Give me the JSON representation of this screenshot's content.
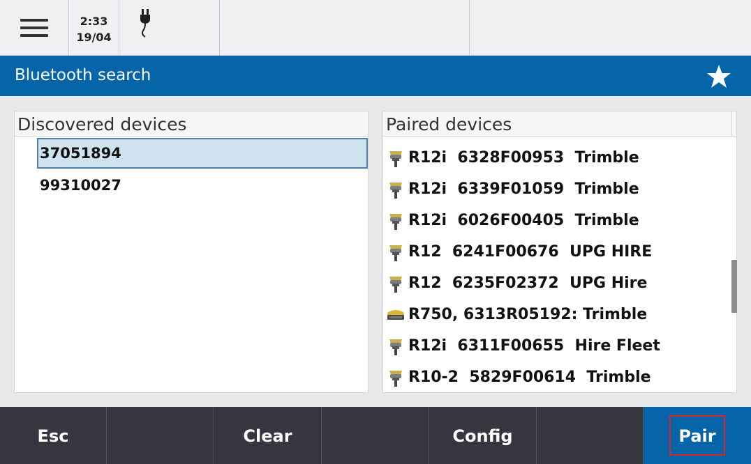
{
  "status": {
    "time": "2:33",
    "date": "19/04",
    "menu_icon": "hamburger-menu-icon",
    "power_icon": "power-plug-icon"
  },
  "titlebar": {
    "title": "Bluetooth search",
    "star_icon": "star-icon"
  },
  "discovered": {
    "header": "Discovered devices",
    "items": [
      "37051894",
      "99310027"
    ],
    "selected_index": 0
  },
  "paired": {
    "header": "Paired devices",
    "items": [
      {
        "label": "R12i  6328F00953  Trimble",
        "icon": "gnss-receiver-icon"
      },
      {
        "label": "R12i  6339F01059  Trimble",
        "icon": "gnss-receiver-icon"
      },
      {
        "label": "R12i  6026F00405  Trimble",
        "icon": "gnss-receiver-icon"
      },
      {
        "label": "R12  6241F00676  UPG HIRE",
        "icon": "gnss-receiver-icon"
      },
      {
        "label": "R12  6235F02372  UPG Hire",
        "icon": "gnss-receiver-icon"
      },
      {
        "label": "R750, 6313R05192: Trimble",
        "icon": "base-receiver-icon"
      },
      {
        "label": "R12i  6311F00655  Hire Fleet",
        "icon": "gnss-receiver-icon"
      },
      {
        "label": "R10-2  5829F00614  Trimble",
        "icon": "gnss-receiver-icon"
      }
    ]
  },
  "softkeys": {
    "esc": "Esc",
    "clear": "Clear",
    "config": "Config",
    "pair": "Pair"
  },
  "colors": {
    "accent": "#0565a8",
    "bottom_bar": "#37353f",
    "selection": "#cfe2ef",
    "highlight_frame": "#e0232a"
  }
}
